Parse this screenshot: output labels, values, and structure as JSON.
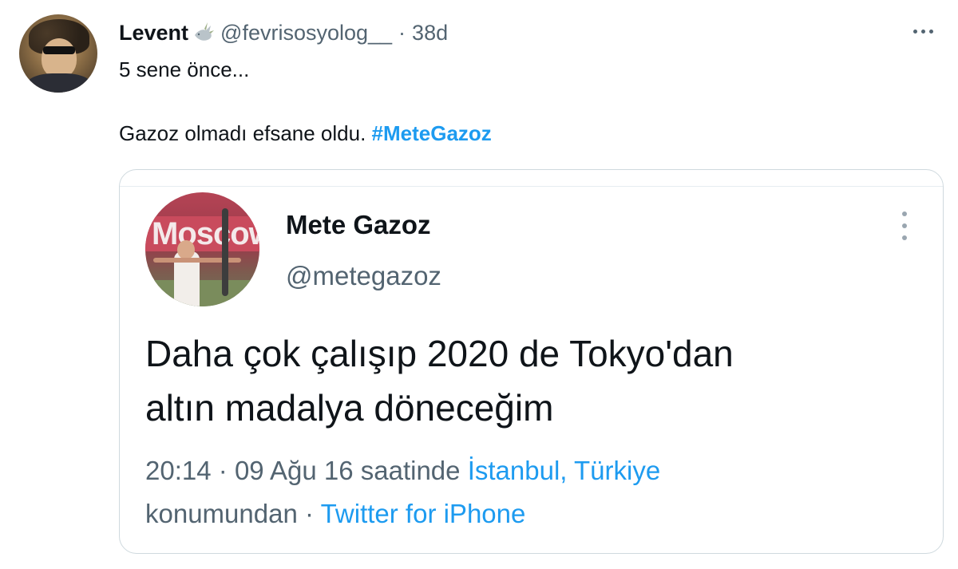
{
  "tweet": {
    "display_name": "Levent",
    "handle": "@fevrisosyolog__",
    "separator": "·",
    "age": "38d",
    "line1": "5 sene önce...",
    "line2": "Gazoz olmadı efsane oldu.",
    "hashtag": "#MeteGazoz"
  },
  "quoted": {
    "avatar_text": "Moscow",
    "name": "Mete Gazoz",
    "handle": "@metegazoz",
    "text_line1": "Daha çok çalışıp 2020 de Tokyo'dan",
    "text_line2": "altın madalya döneceğim",
    "time": "20:14",
    "sep": "·",
    "date_part": "09 Ağu 16 saatinde",
    "location": "İstanbul, Türkiye",
    "location_suffix": "konumundan",
    "source": "Twitter for iPhone"
  },
  "icons": {
    "author_badge": "dove-icon",
    "menu": "more-horizontal-icon",
    "quoted_menu": "more-vertical-icon"
  },
  "colors": {
    "accent": "#1d9bf0",
    "text": "#0f1419",
    "secondary": "#536471",
    "border": "#cfd9de"
  }
}
